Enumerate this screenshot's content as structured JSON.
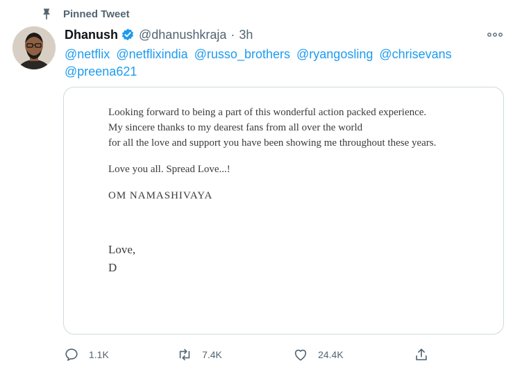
{
  "pinned": {
    "label": "Pinned Tweet"
  },
  "tweet": {
    "author_name": "Dhanush",
    "handle": "@dhanushkraja",
    "separator": "·",
    "time": "3h",
    "mentions": [
      "@netflix",
      "@netflixindia",
      "@russo_brothers",
      "@ryangosling",
      "@chrisevans",
      "@preena621"
    ]
  },
  "letter": {
    "line1": "Looking forward to being a part of this wonderful action packed experience.",
    "line2": "My sincere thanks to my dearest fans from all over the world",
    "line3": "for all the love and support you have been showing me throughout these years.",
    "line4": "Love you all. Spread Love...!",
    "line5": "OM NAMASHIVAYA",
    "line6": "Love,",
    "line7": "D"
  },
  "actions": {
    "reply_count": "1.1K",
    "retweet_count": "7.4K",
    "like_count": "24.4K"
  },
  "colors": {
    "accent": "#1d9bf0",
    "muted": "#536471",
    "text": "#0f1419"
  }
}
